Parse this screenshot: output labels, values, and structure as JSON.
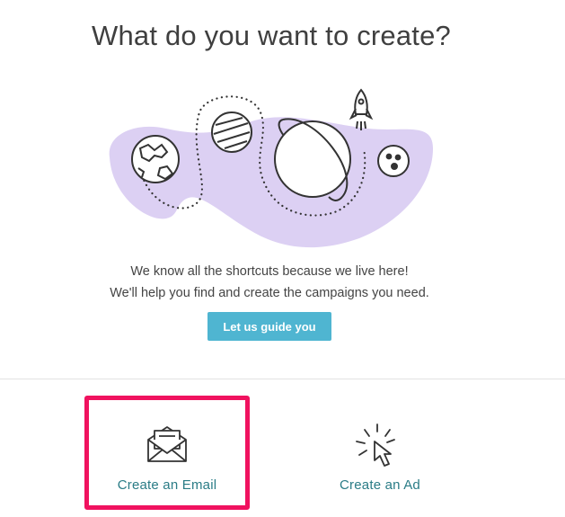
{
  "header": {
    "title": "What do you want to create?"
  },
  "intro": {
    "line1": "We know all the shortcuts because we live here!",
    "line2": "We'll help you find and create the campaigns you need."
  },
  "guide_button": {
    "label": "Let us guide you"
  },
  "options": [
    {
      "label": "Create an Email",
      "icon": "envelope-icon",
      "selected": true
    },
    {
      "label": "Create an Ad",
      "icon": "cursor-click-icon",
      "selected": false
    }
  ],
  "colors": {
    "accent_button": "#4fb5d1",
    "option_label": "#2a7c86",
    "selection_highlight": "#f0125f",
    "blob": "#dcd0f3"
  }
}
